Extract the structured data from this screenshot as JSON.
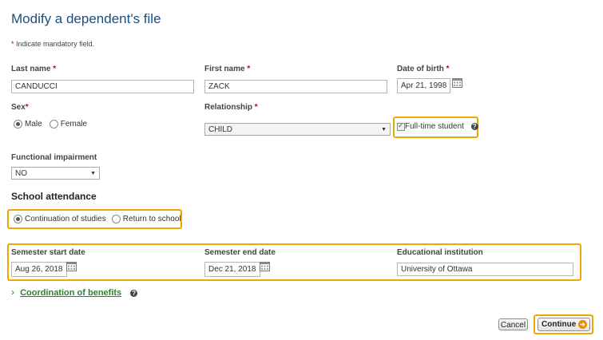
{
  "page": {
    "title": "Modify a dependent's file",
    "mandatory_star": "*",
    "mandatory_note": "Indicate mandatory field."
  },
  "fields": {
    "last_name": {
      "label": "Last name",
      "req": "*",
      "value": "CANDUCCI"
    },
    "first_name": {
      "label": "First name",
      "req": "*",
      "value": "ZACK"
    },
    "dob": {
      "label": "Date of birth",
      "req": "*",
      "value": "Apr 21, 1998"
    },
    "sex": {
      "label": "Sex",
      "req": "*",
      "options": [
        "Male",
        "Female"
      ],
      "selected": "Male"
    },
    "relationship": {
      "label": "Relationship",
      "req": "*",
      "value": "CHILD"
    },
    "full_time": {
      "label": "Full-time student",
      "checked": true
    },
    "impairment": {
      "label": "Functional impairment",
      "value": "NO"
    }
  },
  "school": {
    "title": "School attendance",
    "options": [
      "Continuation of studies",
      "Return to school"
    ],
    "selected": "Continuation of studies",
    "start": {
      "label": "Semester start date",
      "value": "Aug 26, 2018"
    },
    "end": {
      "label": "Semester end date",
      "value": "Dec 21, 2018"
    },
    "institution": {
      "label": "Educational institution",
      "value": "University of Ottawa"
    }
  },
  "coordination": {
    "chevron": "›",
    "label": "Coordination of benefits"
  },
  "buttons": {
    "cancel": "Cancel",
    "continue": "Continue"
  },
  "colors": {
    "highlight": "#f0a500",
    "title": "#1f4e79",
    "link": "#2e7d32",
    "required": "#cc0000"
  }
}
